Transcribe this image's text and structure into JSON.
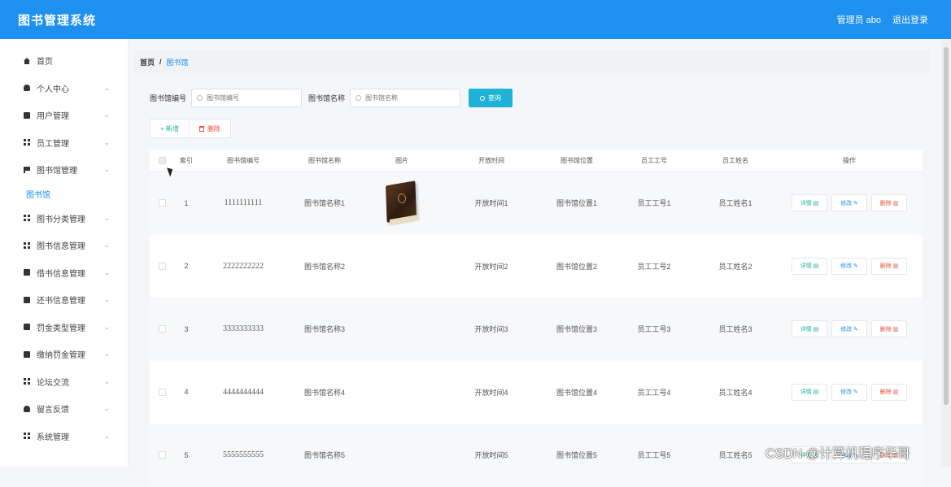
{
  "header": {
    "title": "图书管理系统",
    "user_label": "管理员 abo",
    "logout": "退出登录"
  },
  "sidebar": {
    "items": [
      {
        "label": "首页",
        "icon": "home-icon",
        "expandable": false
      },
      {
        "label": "个人中心",
        "icon": "user-icon",
        "expandable": true
      },
      {
        "label": "用户管理",
        "icon": "doc-icon",
        "expandable": true
      },
      {
        "label": "员工管理",
        "icon": "grid-icon",
        "expandable": true
      },
      {
        "label": "图书馆管理",
        "icon": "flag-icon",
        "expandable": true
      },
      {
        "label": "图书馆",
        "icon": "",
        "expandable": false,
        "sub": true
      },
      {
        "label": "图书分类管理",
        "icon": "grid-icon",
        "expandable": true
      },
      {
        "label": "图书信息管理",
        "icon": "grid-icon",
        "expandable": true
      },
      {
        "label": "借书信息管理",
        "icon": "doc-icon",
        "expandable": true
      },
      {
        "label": "还书信息管理",
        "icon": "doc-icon",
        "expandable": true
      },
      {
        "label": "罚金类型管理",
        "icon": "doc-icon",
        "expandable": true
      },
      {
        "label": "缴纳罚金管理",
        "icon": "doc-icon",
        "expandable": true
      },
      {
        "label": "论坛交流",
        "icon": "grid-icon",
        "expandable": true
      },
      {
        "label": "留言反馈",
        "icon": "user-icon",
        "expandable": true
      },
      {
        "label": "系统管理",
        "icon": "grid-icon",
        "expandable": true
      }
    ]
  },
  "breadcrumb": {
    "home": "首页",
    "sep": "/",
    "current": "图书馆"
  },
  "search": {
    "field1_label": "图书馆编号",
    "field1_placeholder": "图书馆编号",
    "field2_label": "图书馆名称",
    "field2_placeholder": "图书馆名称",
    "query_button": "查询"
  },
  "toolbar": {
    "add": "+ 新增",
    "delete": "删除"
  },
  "table": {
    "headers": [
      "索引",
      "图书馆编号",
      "图书馆名称",
      "图片",
      "开放时间",
      "图书馆位置",
      "员工工号",
      "员工姓名",
      "操作"
    ],
    "rows": [
      {
        "index": "1",
        "no": "1111111111",
        "name": "图书馆名称1",
        "time": "开放时间1",
        "loc": "图书馆位置1",
        "eno": "员工工号1",
        "ename": "员工姓名1",
        "has_image": true
      },
      {
        "index": "2",
        "no": "2222222222",
        "name": "图书馆名称2",
        "time": "开放时间2",
        "loc": "图书馆位置2",
        "eno": "员工工号2",
        "ename": "员工姓名2",
        "has_image": false
      },
      {
        "index": "3",
        "no": "3333333333",
        "name": "图书馆名称3",
        "time": "开放时间3",
        "loc": "图书馆位置3",
        "eno": "员工工号3",
        "ename": "员工姓名3",
        "has_image": false
      },
      {
        "index": "4",
        "no": "4444444444",
        "name": "图书馆名称4",
        "time": "开放时间4",
        "loc": "图书馆位置4",
        "eno": "员工工号4",
        "ename": "员工姓名4",
        "has_image": false
      },
      {
        "index": "5",
        "no": "5555555555",
        "name": "图书馆名称5",
        "time": "开放时间5",
        "loc": "图书馆位置5",
        "eno": "员工工号5",
        "ename": "员工姓名5",
        "has_image": false
      }
    ],
    "op_view": "详情",
    "op_edit": "修改",
    "op_delete": "删除"
  },
  "watermark": "CSDN @计算机程序华哥",
  "colors": {
    "header_bg": "#1e90f0",
    "query_btn": "#20b2d6",
    "add_green": "#1bb394",
    "delete_red": "#e5523b"
  }
}
